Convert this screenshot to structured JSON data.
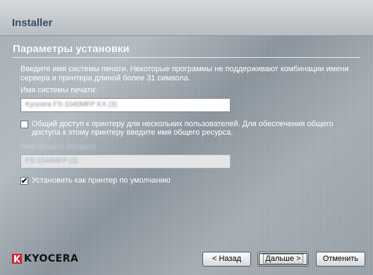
{
  "window": {
    "title": "Installer"
  },
  "section": {
    "title": "Параметры установки",
    "description": "Введите имя системы печати. Некоторые программы не поддерживают комбинации имени сервера и принтера длиной более 31 символа."
  },
  "printer_name": {
    "label": "Имя системы печати:",
    "value": "Kyocera FS-1040MFP KX (3)"
  },
  "share": {
    "checkbox_label": "Общий доступ к принтеру для нескольких пользователей. Для обеспечения общего доступа к этому принтеру введите имя общего ресурса.",
    "checked": false,
    "share_name_label": "Имя общего ресурса:",
    "share_name_value": "FS-1040MFP (3)"
  },
  "default_printer": {
    "checkbox_label": "Установить как принтер по умолчанию",
    "checked": true,
    "check_glyph": "✔"
  },
  "brand": {
    "logo_text": "KYOCERA",
    "accent_color": "#d4202b"
  },
  "buttons": {
    "back": "< Назад",
    "next": "Дальше >",
    "cancel": "Отменить"
  }
}
